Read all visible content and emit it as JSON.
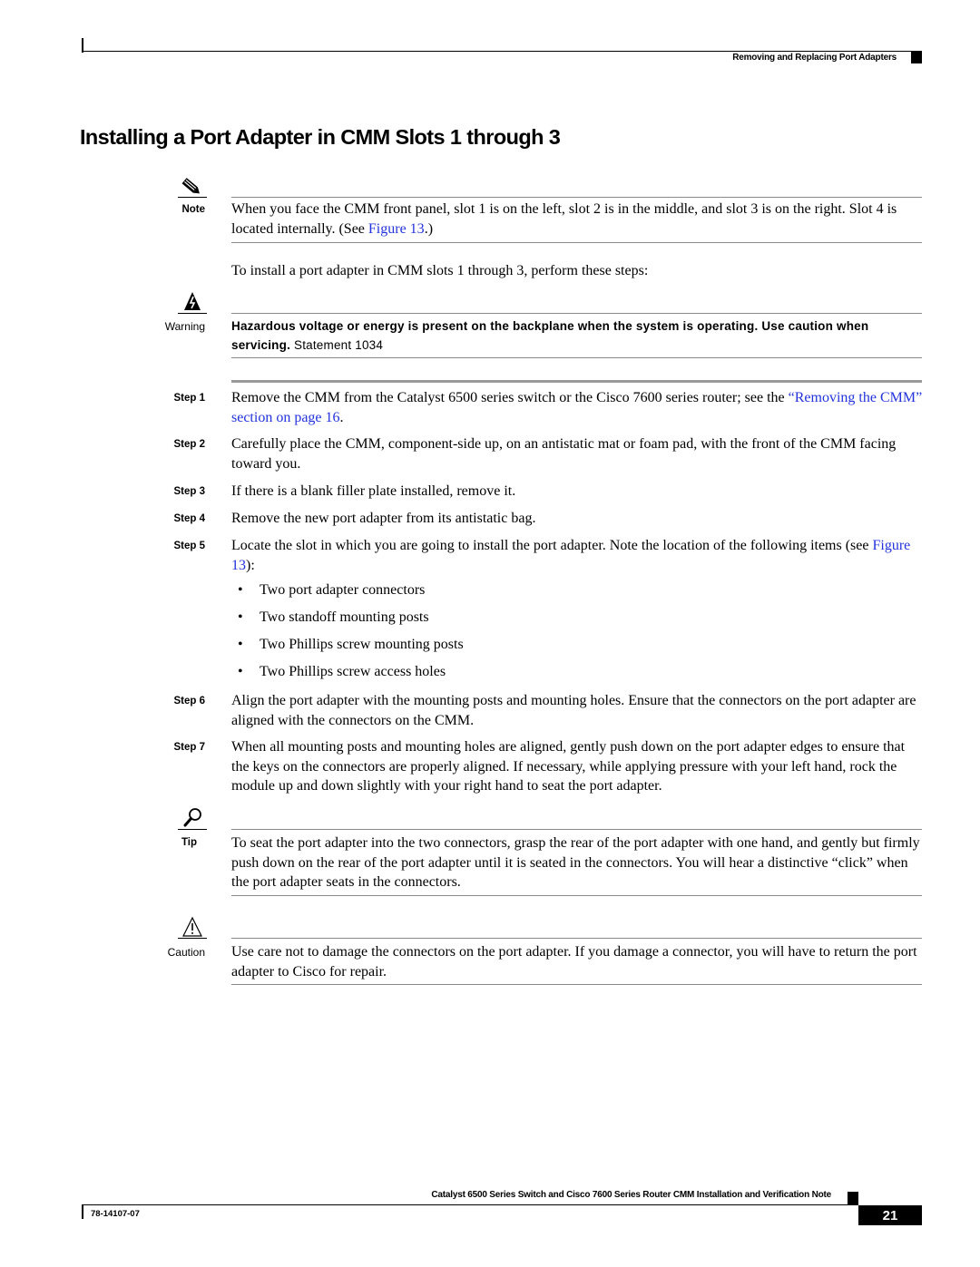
{
  "header": {
    "section": "Removing and Replacing Port Adapters"
  },
  "title": "Installing a Port Adapter in CMM Slots 1 through 3",
  "note": {
    "label": "Note",
    "icon": "pencil-note-icon",
    "text_before": "When you face the CMM front panel, slot 1 is on the left, slot 2 is in the middle, and slot 3 is on the right. Slot 4 is located internally. (See ",
    "link": "Figure 13",
    "text_after": ".)"
  },
  "intro": "To install a port adapter in CMM slots 1 through 3, perform these steps:",
  "warning": {
    "label": "Warning",
    "icon": "electrical-hazard-icon",
    "text": "Hazardous voltage or energy is present on the backplane when the system is operating. Use caution when servicing.",
    "statement": "Statement 1034"
  },
  "steps": [
    {
      "label": "Step 1",
      "text_before": "Remove the CMM from the Catalyst 6500 series switch or the Cisco 7600 series router; see the ",
      "link": "“Removing the CMM” section on page 16",
      "text_after": "."
    },
    {
      "label": "Step 2",
      "text": "Carefully place the CMM, component-side up, on an antistatic mat or foam pad, with the front of the CMM facing toward you."
    },
    {
      "label": "Step 3",
      "text": "If there is a blank filler plate installed, remove it."
    },
    {
      "label": "Step 4",
      "text": "Remove the new port adapter from its antistatic bag."
    },
    {
      "label": "Step 5",
      "text_before": "Locate the slot in which you are going to install the port adapter. Note the location of the following items (see ",
      "link": "Figure 13",
      "text_after": "):",
      "bullets": [
        "Two port adapter connectors",
        "Two standoff mounting posts",
        "Two Phillips screw mounting posts",
        "Two Phillips screw access holes"
      ]
    },
    {
      "label": "Step 6",
      "text": "Align the port adapter with the mounting posts and mounting holes. Ensure that the connectors on the port adapter are aligned with the connectors on the CMM."
    },
    {
      "label": "Step 7",
      "text": "When all mounting posts and mounting holes are aligned, gently push down on the port adapter edges to ensure that the keys on the connectors are properly aligned. If necessary, while applying pressure with your left hand, rock the module up and down slightly with your right hand to seat the port adapter."
    }
  ],
  "tip": {
    "label": "Tip",
    "icon": "magnifier-tip-icon",
    "text": "To seat the port adapter into the two connectors, grasp the rear of the port adapter with one hand, and gently but firmly push down on the rear of the port adapter until it is seated in the connectors. You will hear a distinctive “click” when the port adapter seats in the connectors."
  },
  "caution": {
    "label": "Caution",
    "icon": "caution-triangle-icon",
    "text": "Use care not to damage the connectors on the port adapter. If you damage a connector, you will have to return the port adapter to Cisco for repair."
  },
  "footer": {
    "doc_title": "Catalyst 6500 Series Switch and Cisco 7600 Series Router CMM Installation and Verification Note",
    "doc_number": "78-14107-07",
    "page_number": "21"
  },
  "colors": {
    "link": "#2233dd",
    "rule": "#8a8a8a"
  }
}
